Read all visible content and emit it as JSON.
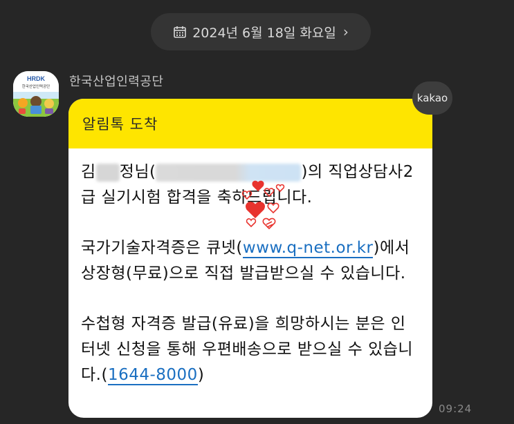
{
  "date_divider": {
    "label": "2024년 6월 18일 화요일",
    "chevron": "›",
    "icon": "calendar-icon"
  },
  "sender": {
    "name": "한국산업인력공단",
    "avatar_text": "HRDK",
    "avatar_subtext": "한국산업인력공단"
  },
  "badge": {
    "label": "kakao"
  },
  "message": {
    "header_title": "알림톡 도착",
    "greeting_prefix": "김",
    "greeting_middle": "정님(",
    "greeting_suffix": ")의 직업상담사2급 실기시험 합격을 축하드립니다.",
    "p2_before": "국가기술자격증은 큐넷(",
    "p2_link": "www.q-net.or.kr",
    "p2_after": ")에서 상장형(무료)으로 직접 발급받으실 수 있습니다.",
    "p3_before": "수첩형 자격증 발급(유료)을 희망하시는 분은 인터넷 신청을 통해 우편배송으로 받으실 수 있습니다.(",
    "p3_link": "1644-8000",
    "p3_after": ")"
  },
  "timestamp": "09:24",
  "colors": {
    "background": "#262626",
    "header_yellow": "#fee500",
    "link_blue": "#1a6fc1",
    "heart_red": "#e8332e"
  }
}
